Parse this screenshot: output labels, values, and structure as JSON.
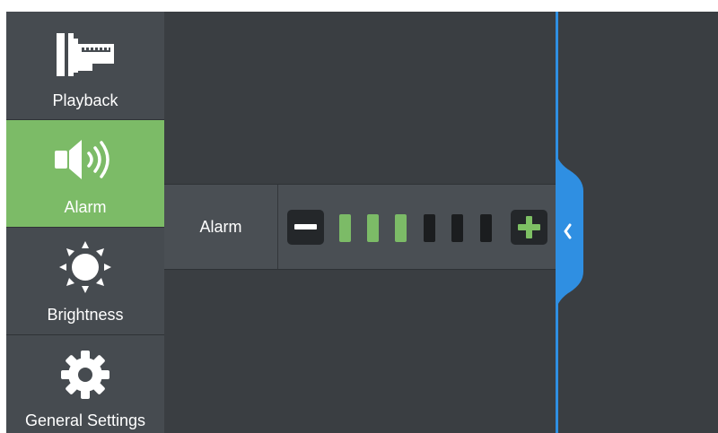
{
  "sidebar": {
    "items": [
      {
        "label": "Playback",
        "icon": "film-icon",
        "active": false
      },
      {
        "label": "Alarm",
        "icon": "speaker-icon",
        "active": true
      },
      {
        "label": "Brightness",
        "icon": "sun-icon",
        "active": false
      },
      {
        "label": "General Settings",
        "icon": "gear-icon",
        "active": false
      }
    ]
  },
  "alarm_row": {
    "label": "Alarm",
    "level": 3,
    "max_level": 6,
    "decrease_icon": "minus-icon",
    "increase_icon": "plus-icon"
  },
  "panel_toggle": {
    "icon": "chevron-left-icon"
  },
  "colors": {
    "accent_green": "#7cbb67",
    "accent_blue": "#2f8fe2",
    "background": "#3a3e42",
    "sidebar": "#464b50"
  }
}
